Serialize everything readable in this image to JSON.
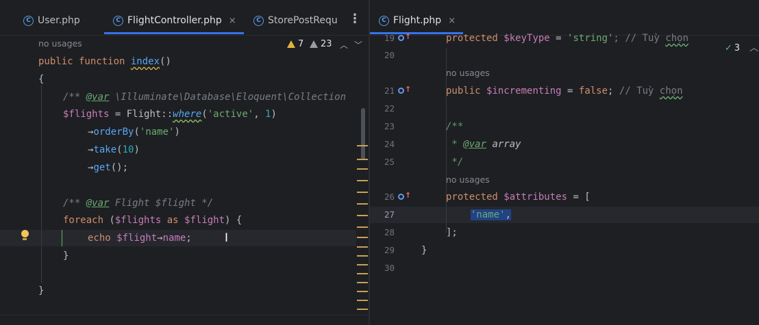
{
  "left_editor": {
    "tabs": [
      {
        "label": "User.php",
        "active": false
      },
      {
        "label": "FlightController.php",
        "active": true,
        "close": "×"
      },
      {
        "label": "StorePostRequ",
        "active": false
      }
    ],
    "menu_icon": "kebab-icon",
    "inspections": {
      "warnings": "7",
      "weak_warnings": "23"
    },
    "usage_hint": "no usages",
    "code": {
      "l1_kw": "public function ",
      "l1_fn": "index",
      "l1_end": "()",
      "l2": "{",
      "l3_open": "/** ",
      "l3_tag": "@var",
      "l3_type": " \\Illuminate\\Database\\Eloquent\\Collection",
      "l4_var": "$flights",
      "l4_mid": " = Flight::",
      "l4_fn": "where",
      "l4_p1": "(",
      "l4_str": "'active'",
      "l4_p2": ", ",
      "l4_num": "1",
      "l4_p3": ")",
      "l5_arrow": "→",
      "l5_fn": "orderBy",
      "l5_p1": "(",
      "l5_str": "'name'",
      "l5_p2": ")",
      "l6_arrow": "→",
      "l6_fn": "take",
      "l6_p1": "(",
      "l6_num": "10",
      "l6_p2": ")",
      "l7_arrow": "→",
      "l7_fn": "get",
      "l7_end": "();",
      "l8_open": "/** ",
      "l8_tag": "@var",
      "l8_rest": " Flight $flight */",
      "l9_kw": "foreach",
      "l9_p1": " (",
      "l9_var1": "$flights",
      "l9_as": " as ",
      "l9_var2": "$flight",
      "l9_end": ") {",
      "l10_kw": "echo ",
      "l10_var": "$flight",
      "l10_arrow": "→",
      "l10_prop": "name",
      "l10_end": ";",
      "l11": "}",
      "l12": "}"
    }
  },
  "right_editor": {
    "tabs": [
      {
        "label": "Flight.php",
        "active": true,
        "close": "×"
      }
    ],
    "inspections": {
      "ok_count": "3"
    },
    "line_numbers": [
      "19",
      "20",
      "21",
      "22",
      "23",
      "24",
      "25",
      "26",
      "27",
      "28",
      "29",
      "30"
    ],
    "usage_hints": [
      "no usages",
      "no usages"
    ],
    "code": {
      "l19_kw": "protected ",
      "l19_var": "$keyType",
      "l19_mid": " = ",
      "l19_str": "'string'",
      "l19_cmt": "; // Tuỳ ",
      "l19_cmt2": "chọn",
      "l21_kw": "public ",
      "l21_var": "$incrementing",
      "l21_mid": " = ",
      "l21_kw2": "false",
      "l21_end": "; ",
      "l21_cmt": "// Tuỳ ",
      "l21_cmt2": "chọn",
      "l23": "/**",
      "l24_star": " * ",
      "l24_tag": "@var",
      "l24_rest": " array",
      "l25": " */",
      "l26_kw": "protected ",
      "l26_var": "$attributes",
      "l26_end": " = [",
      "l27_str": "'name'",
      "l27_end": ",",
      "l28": "];",
      "l29": "}"
    }
  }
}
